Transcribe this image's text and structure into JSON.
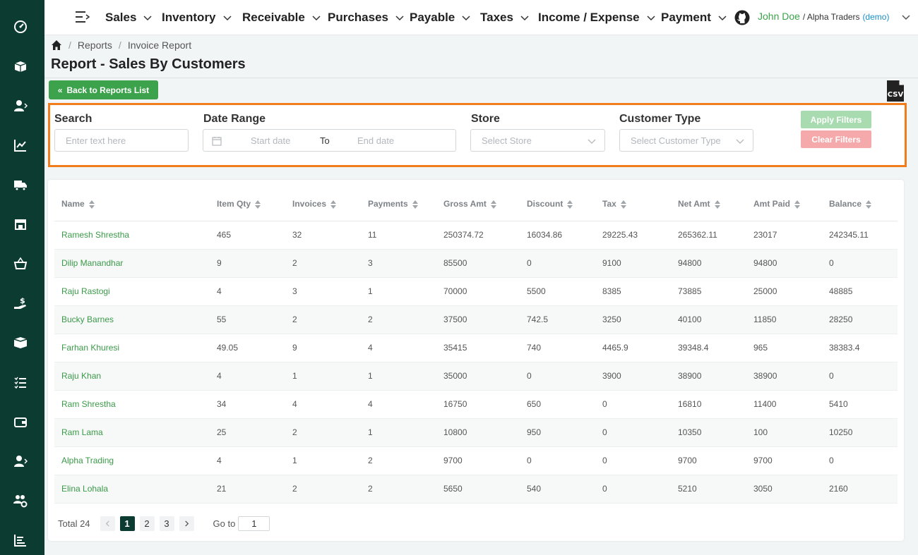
{
  "sidebar": {
    "icons": [
      "dashboard-icon",
      "package-icon",
      "customer-icon",
      "chart-line-icon",
      "truck-icon",
      "store-icon",
      "basket-icon",
      "hand-money-icon",
      "boxes-icon",
      "list-check-icon",
      "wallet-icon",
      "user-arrow-icon",
      "users-gear-icon",
      "report-chart-icon"
    ]
  },
  "nav": {
    "items": [
      "Sales",
      "Inventory",
      "Receivable",
      "Purchases",
      "Payable",
      "Taxes",
      "Income / Expense",
      "Payment"
    ],
    "user_name": "John Doe",
    "org": "/ Alpha Traders",
    "demo": "(demo)"
  },
  "breadcrumb": {
    "items": [
      "Reports",
      "Invoice Report"
    ]
  },
  "page": {
    "title": "Report - Sales By Customers"
  },
  "back_button": "Back to Reports List",
  "csv_label": "CSV",
  "filters": {
    "search_label": "Search",
    "search_placeholder": "Enter text here",
    "date_label": "Date Range",
    "date_start": "Start date",
    "date_to": "To",
    "date_end": "End date",
    "store_label": "Store",
    "store_placeholder": "Select Store",
    "customer_type_label": "Customer Type",
    "customer_type_placeholder": "Select Customer Type",
    "apply": "Apply Filters",
    "clear": "Clear Filters"
  },
  "table": {
    "headers": [
      "Name",
      "Item Qty",
      "Invoices",
      "Payments",
      "Gross Amt",
      "Discount",
      "Tax",
      "Net Amt",
      "Amt Paid",
      "Balance"
    ],
    "rows": [
      [
        "Ramesh Shrestha",
        "465",
        "32",
        "11",
        "250374.72",
        "16034.86",
        "29225.43",
        "265362.11",
        "23017",
        "242345.11"
      ],
      [
        "Dilip Manandhar",
        "9",
        "2",
        "3",
        "85500",
        "0",
        "9100",
        "94800",
        "94800",
        "0"
      ],
      [
        "Raju Rastogi",
        "4",
        "3",
        "1",
        "70000",
        "5500",
        "8385",
        "73885",
        "25000",
        "48885"
      ],
      [
        "Bucky Barnes",
        "55",
        "2",
        "2",
        "37500",
        "742.5",
        "3250",
        "40100",
        "11850",
        "28250"
      ],
      [
        "Farhan Khuresi",
        "49.05",
        "9",
        "4",
        "35415",
        "740",
        "4465.9",
        "39348.4",
        "965",
        "38383.4"
      ],
      [
        "Raju Khan",
        "4",
        "1",
        "1",
        "35000",
        "0",
        "3900",
        "38900",
        "38900",
        "0"
      ],
      [
        "Ram Shrestha",
        "34",
        "4",
        "4",
        "16750",
        "650",
        "0",
        "16810",
        "11400",
        "5410"
      ],
      [
        "Ram Lama",
        "25",
        "2",
        "1",
        "10800",
        "950",
        "0",
        "10350",
        "100",
        "10250"
      ],
      [
        "Alpha Trading",
        "4",
        "1",
        "2",
        "9700",
        "0",
        "0",
        "9700",
        "9700",
        "0"
      ],
      [
        "Elina Lohala",
        "21",
        "2",
        "2",
        "5650",
        "540",
        "0",
        "5210",
        "3050",
        "2160"
      ]
    ]
  },
  "pagination": {
    "total": "Total 24",
    "pages": [
      "1",
      "2",
      "3"
    ],
    "current": "1",
    "goto_label": "Go to",
    "goto_value": "1"
  }
}
